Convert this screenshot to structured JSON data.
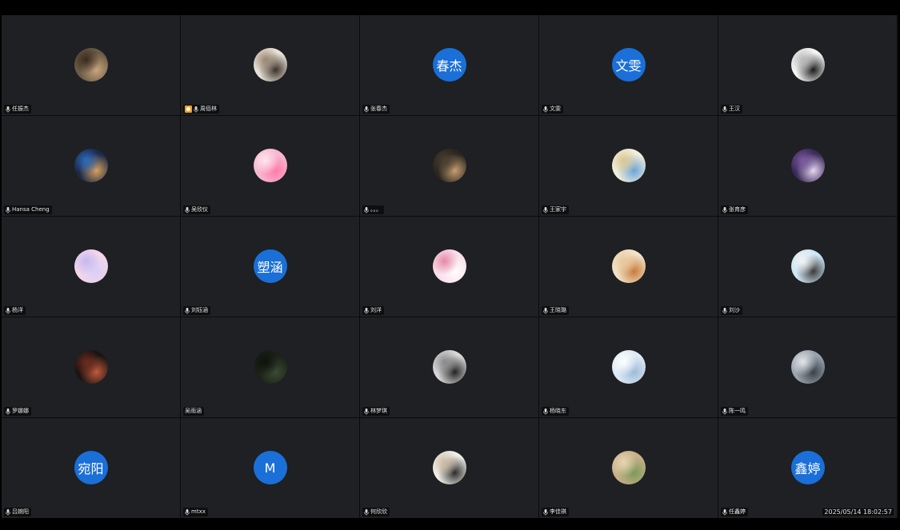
{
  "timestamp": "2025/05/14 18:02:57",
  "tiles": [
    {
      "name": "任振杰",
      "avatar": {
        "type": "photo",
        "colors": [
          "#6b5a46",
          "#c9a77d",
          "#3a2a1f"
        ]
      }
    },
    {
      "name": "周佰林",
      "host": true,
      "avatar": {
        "type": "photo",
        "colors": [
          "#e8e2d8",
          "#3a3128",
          "#9a8672"
        ]
      }
    },
    {
      "name": "张春杰",
      "avatar": {
        "type": "text",
        "text": "春杰"
      }
    },
    {
      "name": "文雯",
      "avatar": {
        "type": "text",
        "text": "文雯"
      }
    },
    {
      "name": "王汉",
      "avatar": {
        "type": "photo",
        "colors": [
          "#f4f4f4",
          "#1b1b1b",
          "#b8b8b8"
        ]
      }
    },
    {
      "name": "Hansa Cheng",
      "avatar": {
        "type": "photo",
        "colors": [
          "#1c2a4a",
          "#d9a15c",
          "#2d6cc0"
        ]
      }
    },
    {
      "name": "吴欣仪",
      "avatar": {
        "type": "photo",
        "colors": [
          "#f7b8cf",
          "#ff7aa8",
          "#fde6ee"
        ]
      }
    },
    {
      "name": "。。。",
      "avatar": {
        "type": "photo",
        "colors": [
          "#2a2620",
          "#c8a070",
          "#4a3f30"
        ]
      }
    },
    {
      "name": "王家宇",
      "avatar": {
        "type": "photo",
        "colors": [
          "#f2eedc",
          "#6aa4d6",
          "#d9c790"
        ]
      }
    },
    {
      "name": "张育彦",
      "avatar": {
        "type": "photo",
        "colors": [
          "#3b2a5a",
          "#e7d7f0",
          "#7c5aa0"
        ]
      }
    },
    {
      "name": "杨洋",
      "avatar": {
        "type": "photo",
        "colors": [
          "#f3d6ea",
          "#d9cff5",
          "#c4b8f0"
        ]
      }
    },
    {
      "name": "刘钰涵",
      "avatar": {
        "type": "text",
        "text": "塑涵"
      }
    },
    {
      "name": "刘洋",
      "avatar": {
        "type": "photo",
        "colors": [
          "#f9dde8",
          "#ffffff",
          "#e58aa8"
        ]
      }
    },
    {
      "name": "王晓璐",
      "avatar": {
        "type": "photo",
        "colors": [
          "#f1e3c8",
          "#c87a3a",
          "#e9c89a"
        ]
      }
    },
    {
      "name": "刘沙",
      "avatar": {
        "type": "photo",
        "colors": [
          "#cfe6f5",
          "#3a3a3a",
          "#f4f4f4"
        ]
      }
    },
    {
      "name": "罗娜娜",
      "avatar": {
        "type": "photo",
        "colors": [
          "#1a1412",
          "#c45a3a",
          "#6b2a1e"
        ]
      }
    },
    {
      "name": "吴雨涵",
      "nomic": true,
      "avatar": {
        "type": "photo",
        "colors": [
          "#1b2219",
          "#3c4a33",
          "#0e120c"
        ]
      }
    },
    {
      "name": "林梦琪",
      "avatar": {
        "type": "photo",
        "colors": [
          "#d8d8d8",
          "#222",
          "#8a8a8a"
        ]
      }
    },
    {
      "name": "杨晓东",
      "avatar": {
        "type": "photo",
        "colors": [
          "#dfeaf5",
          "#9cbad8",
          "#ffffff"
        ]
      }
    },
    {
      "name": "陈一鸣",
      "avatar": {
        "type": "photo",
        "colors": [
          "#9aa4ae",
          "#3a4048",
          "#e2e6ea"
        ]
      }
    },
    {
      "name": "吕婉阳",
      "avatar": {
        "type": "text",
        "text": "宛阳"
      }
    },
    {
      "name": "mtxx",
      "avatar": {
        "type": "text",
        "text": "M"
      }
    },
    {
      "name": "何欣欣",
      "avatar": {
        "type": "photo",
        "colors": [
          "#f0ede6",
          "#2a2a2a",
          "#c9b9a0"
        ]
      }
    },
    {
      "name": "李佳祺",
      "avatar": {
        "type": "photo",
        "colors": [
          "#c9b08a",
          "#7a9a5a",
          "#e8d6b2"
        ]
      }
    },
    {
      "name": "任鑫婷",
      "avatar": {
        "type": "text",
        "text": "鑫婷"
      }
    }
  ]
}
